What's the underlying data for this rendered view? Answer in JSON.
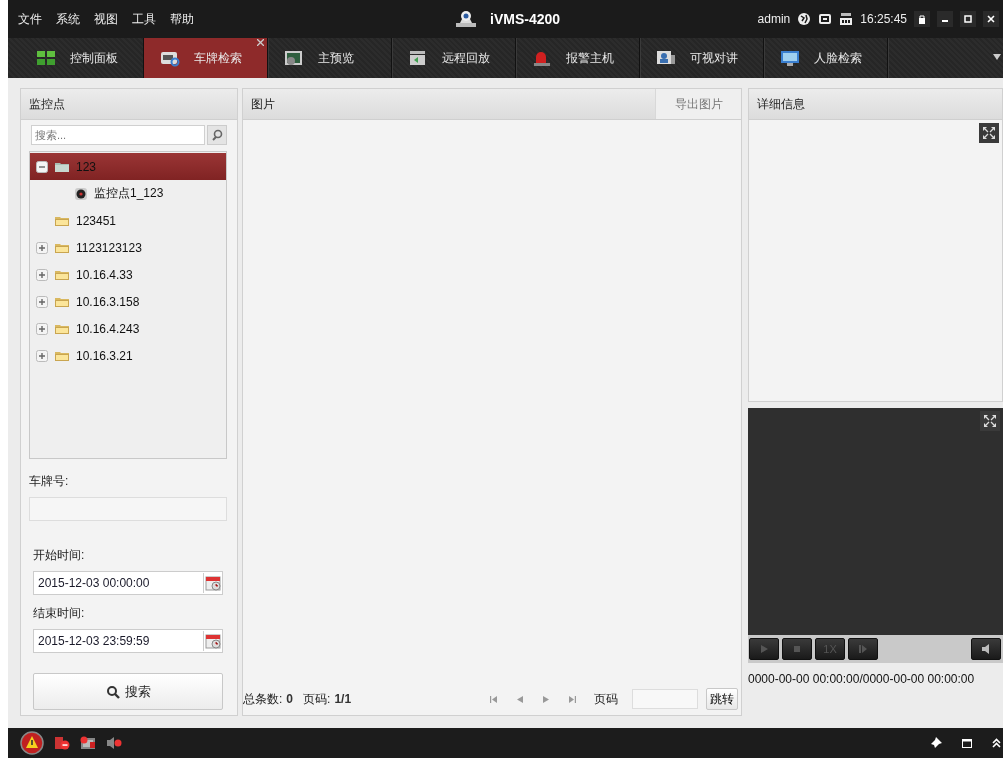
{
  "menu": [
    "文件",
    "系统",
    "视图",
    "工具",
    "帮助"
  ],
  "app_title": "iVMS-4200",
  "user": "admin",
  "clock": "16:25:45",
  "tabs": [
    {
      "label": "控制面板",
      "selected": false,
      "kind": "grid"
    },
    {
      "label": "车牌检索",
      "selected": true,
      "kind": "plate"
    },
    {
      "label": "主预览",
      "selected": false,
      "kind": "preview"
    },
    {
      "label": "远程回放",
      "selected": false,
      "kind": "playback"
    },
    {
      "label": "报警主机",
      "selected": false,
      "kind": "alarm"
    },
    {
      "label": "可视对讲",
      "selected": false,
      "kind": "intercom"
    },
    {
      "label": "人脸检索",
      "selected": false,
      "kind": "face"
    }
  ],
  "left_panel": {
    "title": "监控点",
    "search": {
      "placeholder": "搜索..."
    },
    "tree": [
      {
        "label": "123",
        "kind": "group",
        "expanded": true,
        "selected": true,
        "children": [
          {
            "label": "监控点1_123",
            "kind": "camera",
            "selected": false
          }
        ]
      },
      {
        "label": "123451",
        "kind": "folder",
        "selected": false
      },
      {
        "label": "1123123123",
        "kind": "group",
        "expanded": false,
        "selected": false
      },
      {
        "label": "10.16.4.33",
        "kind": "group",
        "expanded": false,
        "selected": false
      },
      {
        "label": "10.16.3.158",
        "kind": "group",
        "expanded": false,
        "selected": false
      },
      {
        "label": "10.16.4.243",
        "kind": "group",
        "expanded": false,
        "selected": false
      },
      {
        "label": "10.16.3.21",
        "kind": "group",
        "expanded": false,
        "selected": false
      }
    ],
    "plate_label": "车牌号:",
    "start_label": "开始时间:",
    "start_value": "2015-12-03 00:00:00",
    "end_label": "结束时间:",
    "end_value": "2015-12-03 23:59:59",
    "search_button": "搜索"
  },
  "picture_panel": {
    "title": "图片",
    "export_button": "导出图片",
    "total_label": "总条数:",
    "total": "0",
    "page_label": "页码:",
    "page": "1/1",
    "goto_label": "页码",
    "goto_button": "跳转"
  },
  "detail_panel": {
    "title": "详细信息",
    "speed": "1X",
    "time_range": "0000-00-00 00:00:00/0000-00-00 00:00:00"
  }
}
